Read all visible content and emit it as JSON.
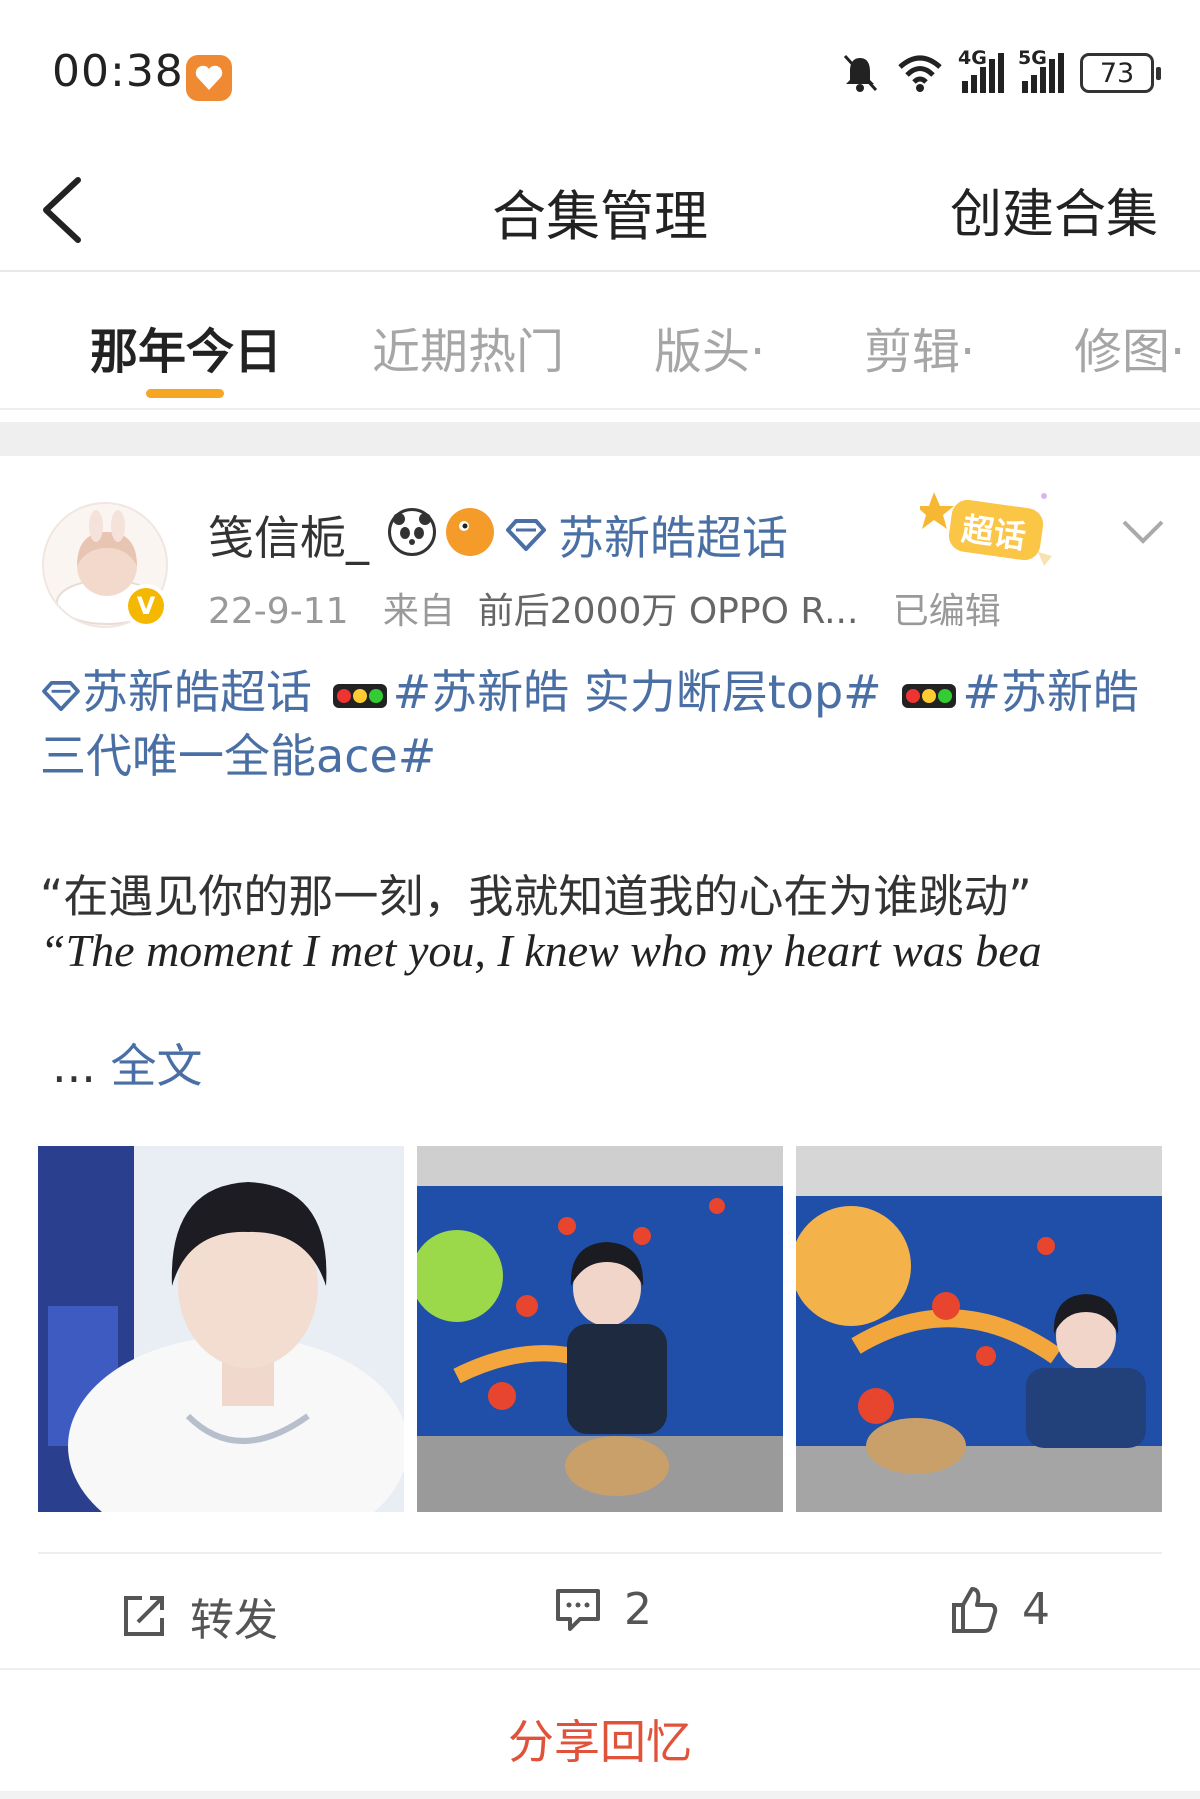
{
  "status_bar": {
    "time": "00:38",
    "net1": "4G",
    "net2": "5G",
    "battery": "73"
  },
  "nav": {
    "title": "合集管理",
    "action": "创建合集"
  },
  "tabs": [
    {
      "label": "那年今日",
      "active": true
    },
    {
      "label": "近期热门",
      "active": false
    },
    {
      "label": "版头·",
      "active": false
    },
    {
      "label": "剪辑·",
      "active": false
    },
    {
      "label": "修图·",
      "active": false
    }
  ],
  "post": {
    "author": "笺信栀_",
    "author_topic": "苏新皓超话",
    "badge_label": "超话",
    "verified_mark": "V",
    "date": "22-9-11",
    "source_prefix": "来自",
    "source": "前后2000万 OPPO R...",
    "edited": "已编辑",
    "topic_prefix": "苏新皓超话",
    "hashtag1": "#苏新皓 实力断层top#",
    "hashtag2": "#苏新皓",
    "hashtag2_cont": "三代唯一全能ace#",
    "quote_cn": "“在遇见你的那一刻，我就知道我的心在为谁跳动”",
    "quote_en": "“The moment I met you, I knew who my heart was bea",
    "ellipsis": "...",
    "read_more": "全文",
    "actions": {
      "repost": "转发",
      "comments": "2",
      "likes": "4"
    },
    "share": "分享回忆"
  },
  "colors": {
    "accent": "#f6a623",
    "link": "#4a6fa5",
    "share": "#e0533a"
  }
}
